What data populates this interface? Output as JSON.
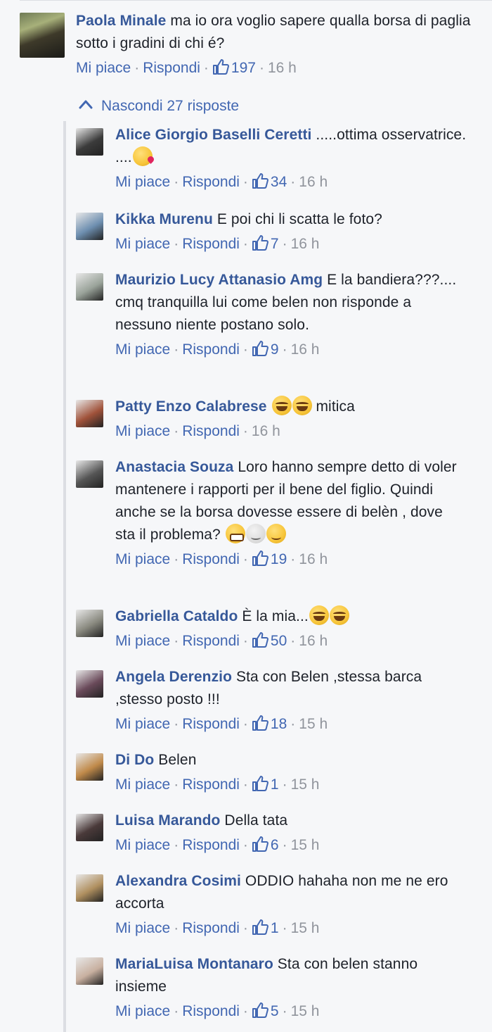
{
  "main_comment": {
    "author": "Paola Minale",
    "text": "ma io ora voglio sapere qualla borsa di paglia sotto i gradini di chi é?",
    "like_label": "Mi piace",
    "reply_label": "Rispondi",
    "likes": "197",
    "time": "16 h"
  },
  "toggle_label": "Nascondi 27 risposte",
  "replies": [
    {
      "author": "Alice Giorgio Baselli Ceretti",
      "text": " .....ottima osservatrice. ....",
      "emojis": [
        "kiss"
      ],
      "likes": "34",
      "time": "16 h",
      "avatar": "#3b3b3b"
    },
    {
      "author": "Kikka Murenu",
      "text": " E poi chi li scatta le foto?",
      "emojis": [],
      "likes": "7",
      "time": "16 h",
      "avatar": "#6e8fb0"
    },
    {
      "author": "Maurizio Lucy Attanasio Amg",
      "text": " E la bandiera???.... cmq tranquilla lui come belen non risponde a nessuno niente postano solo.",
      "emojis": [],
      "likes": "9",
      "time": "16 h",
      "avatar": "#9aa39a"
    },
    {
      "author": "Patty Enzo Calabrese",
      "text": " ",
      "text_after": " mitica",
      "emojis": [
        "laugh",
        "laugh"
      ],
      "likes": "",
      "time": "16 h",
      "avatar": "#a0523a"
    },
    {
      "author": "Anastacia Souza",
      "text": " Loro hanno sempre detto di voler mantenere i rapporti per il bene del figlio. Quindi anche se la borsa dovesse essere di belèn , dove sta il problema? ",
      "emojis": [
        "grin",
        "relieved",
        "smile"
      ],
      "likes": "19",
      "time": "16 h",
      "avatar": "#555555"
    },
    {
      "author": "Gabriella Cataldo",
      "text": " È la mia...",
      "emojis": [
        "laugh",
        "laugh"
      ],
      "likes": "50",
      "time": "16 h",
      "avatar": "#8a8a80"
    },
    {
      "author": "Angela Derenzio",
      "text": " Sta con Belen ,stessa barca ,stesso posto !!!",
      "emojis": [],
      "likes": "18",
      "time": "15 h",
      "avatar": "#6a4a5a"
    },
    {
      "author": "Di Do",
      "text": " Belen",
      "emojis": [],
      "likes": "1",
      "time": "15 h",
      "avatar": "#c08a4a"
    },
    {
      "author": "Luisa Marando",
      "text": " Della tata",
      "emojis": [],
      "likes": "6",
      "time": "15 h",
      "avatar": "#4a3a3a"
    },
    {
      "author": "Alexandra Cosimi",
      "text": " ODDIO hahaha non me ne ero accorta",
      "emojis": [],
      "likes": "1",
      "time": "15 h",
      "avatar": "#b09060"
    },
    {
      "author": "MariaLuisa Montanaro",
      "text": " Sta con belen stanno insieme",
      "emojis": [],
      "likes": "5",
      "time": "15 h",
      "avatar": "#c8b0a0"
    }
  ],
  "colors": {
    "author": "#365899",
    "link": "#4267b2",
    "meta": "#90949c",
    "background": "#f6f7f9"
  }
}
